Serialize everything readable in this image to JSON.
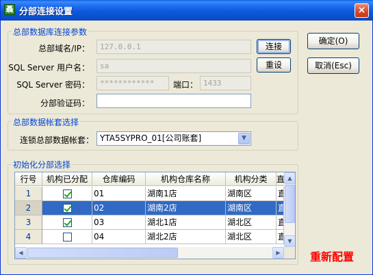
{
  "window": {
    "title": "分部连接设置",
    "app_icon_glyph": "聶",
    "close_glyph": "×",
    "colors": {
      "titlebar": "#0a57d8",
      "legend": "#0046d5",
      "accent_red": "#ff0000",
      "selection": "#316ac5"
    }
  },
  "group_connection": {
    "legend": "总部数据库连接参数",
    "domain_label": "总部域名/IP：",
    "domain_value": "127.0.0.1",
    "user_label": "SQL Server 用户名：",
    "user_value": "sa",
    "password_label": "SQL Server 密码：",
    "password_value": "************",
    "port_label": "端口：",
    "port_value": "1433",
    "verify_label": "分部验证码：",
    "verify_value": "",
    "connect_button": "连接",
    "reset_button": "重设"
  },
  "group_account": {
    "legend": "总部数据帐套选择",
    "account_label": "连锁总部数据帐套：",
    "account_value": "YTA5SYPRO_01[公司账套]",
    "dropdown_icon": "chevron-down-icon"
  },
  "group_init": {
    "legend": "初始化分部选择",
    "columns": [
      "行号",
      "机构已分配",
      "仓库编码",
      "机构仓库名称",
      "机构分类",
      "直"
    ],
    "rows": [
      {
        "num": "1",
        "assigned": true,
        "code": "01",
        "name": "湖南1店",
        "category": "湖南区",
        "extra": "直"
      },
      {
        "num": "2",
        "assigned": true,
        "code": "02",
        "name": "湖南2店",
        "category": "湖南区",
        "extra": "直"
      },
      {
        "num": "3",
        "assigned": true,
        "code": "03",
        "name": "湖北1店",
        "category": "湖北区",
        "extra": "直"
      },
      {
        "num": "4",
        "assigned": false,
        "code": "04",
        "name": "湖北2店",
        "category": "湖北区",
        "extra": "直"
      }
    ],
    "selected_row": 1
  },
  "buttons": {
    "ok": "确定(O)",
    "cancel": "取消(Esc)"
  },
  "reconfigure_label": "重新配置"
}
